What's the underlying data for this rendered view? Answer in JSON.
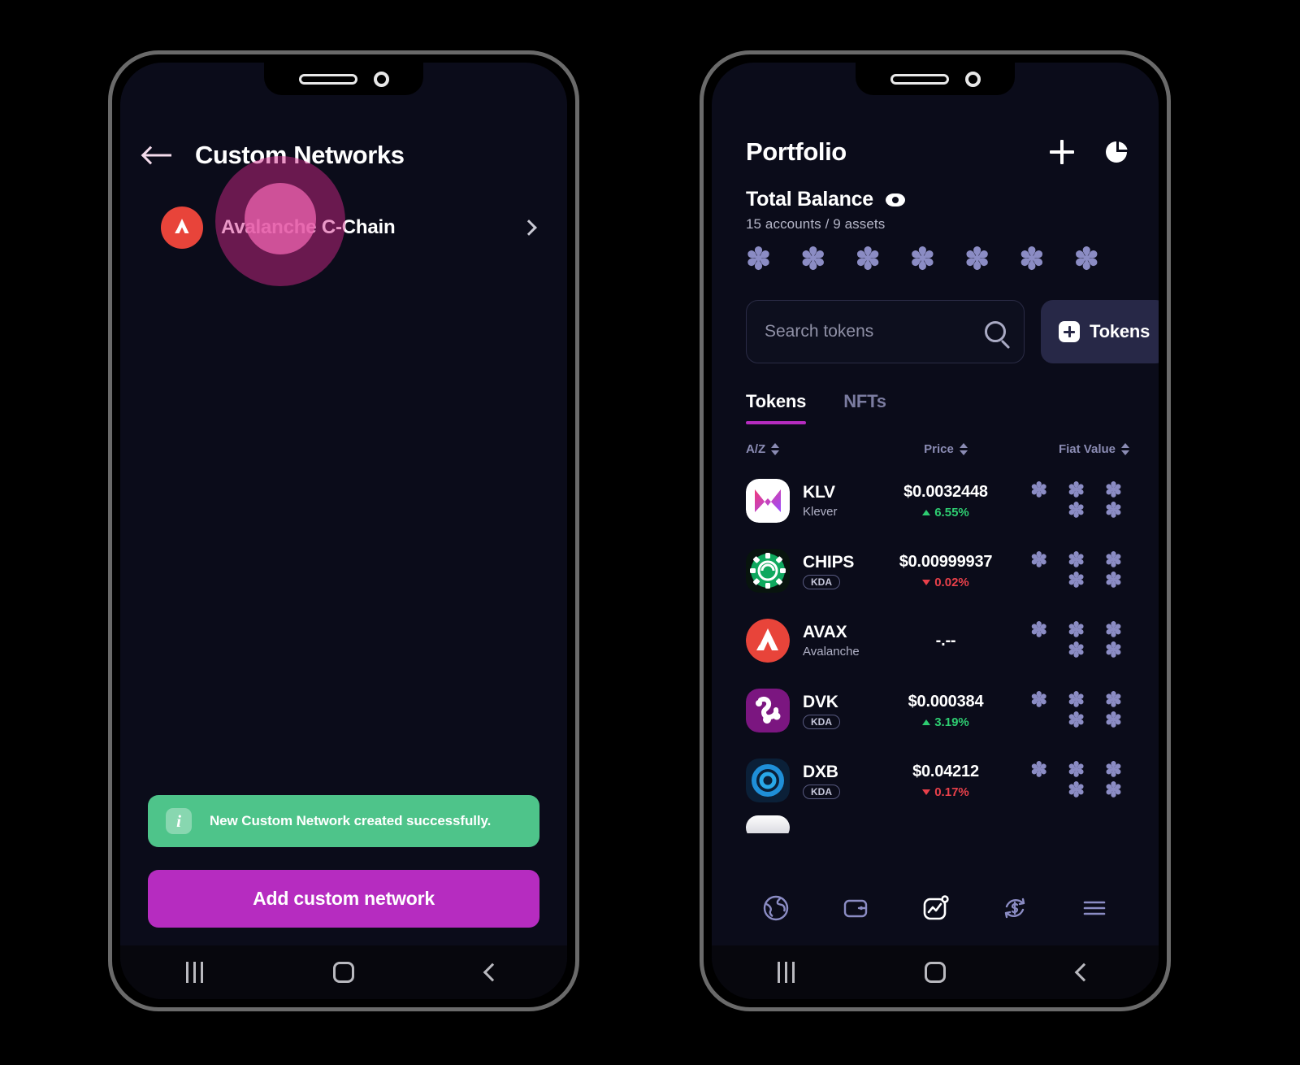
{
  "left_phone": {
    "screen_name": "custom-networks",
    "header": {
      "title": "Custom Networks",
      "back_icon": "arrow-left-icon"
    },
    "networks": [
      {
        "name": "Avalanche C-Chain",
        "icon": "avalanche-icon",
        "icon_color": "#e8443a",
        "chevron": "chevron-right-icon"
      }
    ],
    "toast": {
      "icon": "info-icon",
      "icon_glyph": "i",
      "message": "New Custom Network created successfully.",
      "bg_color": "#4ec48a"
    },
    "primary_button": {
      "label": "Add custom network",
      "bg_color": "#b62cc0"
    },
    "click_indicator": {
      "target": "back-button",
      "outer_color": "#d3288a",
      "inner_color": "#e75faa"
    },
    "android_nav": {
      "recents_label": "Recents",
      "home_label": "Home",
      "back_label": "Back"
    }
  },
  "right_phone": {
    "screen_name": "portfolio",
    "header": {
      "title": "Portfolio",
      "actions": [
        {
          "name": "add-button",
          "icon": "plus-icon"
        },
        {
          "name": "chart-button",
          "icon": "pie-chart-icon"
        }
      ]
    },
    "total_balance": {
      "label": "Total Balance",
      "visibility_icon": "eye-icon",
      "subtitle": "15 accounts / 9 assets",
      "masked_value": "✽ ✽ ✽ ✽ ✽ ✽ ✽"
    },
    "search": {
      "placeholder": "Search tokens",
      "value": "",
      "icon": "search-icon"
    },
    "tokens_button": {
      "label": "Tokens",
      "icon": "plus-square-icon",
      "bg_color": "#272847"
    },
    "tabs": [
      {
        "label": "Tokens",
        "active": true
      },
      {
        "label": "NFTs",
        "active": false
      }
    ],
    "accent_color": "#b62cc0",
    "columns": [
      {
        "label": "A/Z",
        "sortable": true
      },
      {
        "label": "Price",
        "sortable": true
      },
      {
        "label": "Fiat Value",
        "sortable": true
      }
    ],
    "tokens": [
      {
        "symbol": "KLV",
        "name": "Klever",
        "badge": "",
        "price": "$0.0032448",
        "change": "6.55%",
        "direction": "up",
        "fiat_masked": "✽ ✽ ✽ ✽ ✽",
        "icon": "klever-icon"
      },
      {
        "symbol": "CHIPS",
        "name": "",
        "badge": "KDA",
        "price": "$0.00999937",
        "change": "0.02%",
        "direction": "down",
        "fiat_masked": "✽ ✽ ✽ ✽ ✽",
        "icon": "chips-icon"
      },
      {
        "symbol": "AVAX",
        "name": "Avalanche",
        "badge": "",
        "price": "-.--",
        "change": "",
        "direction": "none",
        "fiat_masked": "✽ ✽ ✽ ✽ ✽",
        "icon": "avalanche-icon"
      },
      {
        "symbol": "DVK",
        "name": "",
        "badge": "KDA",
        "price": "$0.000384",
        "change": "3.19%",
        "direction": "up",
        "fiat_masked": "✽ ✽ ✽ ✽ ✽",
        "icon": "dvk-icon"
      },
      {
        "symbol": "DXB",
        "name": "",
        "badge": "KDA",
        "price": "$0.04212",
        "change": "0.17%",
        "direction": "down",
        "fiat_masked": "✽ ✽ ✽ ✽ ✽",
        "icon": "dxb-icon"
      }
    ],
    "bottom_nav": [
      {
        "name": "nav-explore",
        "icon": "globe-icon",
        "active": false
      },
      {
        "name": "nav-wallet",
        "icon": "wallet-icon",
        "active": false
      },
      {
        "name": "nav-portfolio",
        "icon": "portfolio-chart-icon",
        "active": true
      },
      {
        "name": "nav-swap",
        "icon": "swap-dollar-icon",
        "active": false
      },
      {
        "name": "nav-menu",
        "icon": "hamburger-menu-icon",
        "active": false
      }
    ],
    "android_nav": {
      "recents_label": "Recents",
      "home_label": "Home",
      "back_label": "Back"
    }
  }
}
